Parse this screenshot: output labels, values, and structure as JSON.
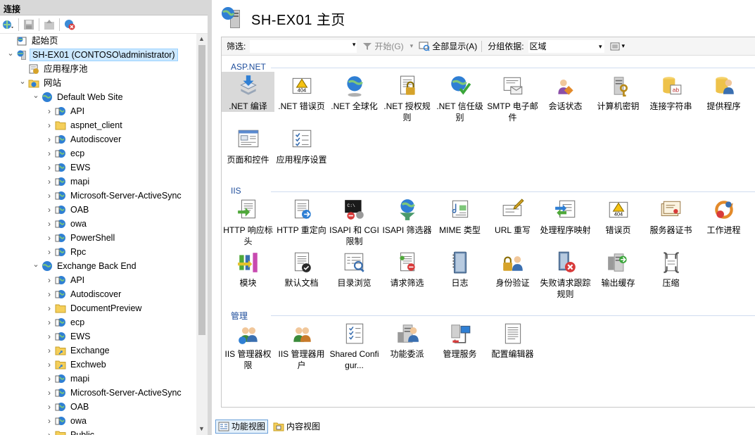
{
  "connections": {
    "header": "连接",
    "toolbar": [
      "connect-icon",
      "save-icon",
      "up-icon",
      "disconnect-icon"
    ],
    "tree": [
      {
        "label": "起始页",
        "level": 0,
        "icon": "start-page-icon",
        "exp": ""
      },
      {
        "label": "SH-EX01 (CONTOSO\\administrator)",
        "level": 0,
        "icon": "server-icon",
        "exp": "open",
        "selected": true
      },
      {
        "label": "应用程序池",
        "level": 1,
        "icon": "app-pool-icon",
        "exp": ""
      },
      {
        "label": "网站",
        "level": 1,
        "icon": "sites-folder-icon",
        "exp": "open"
      },
      {
        "label": "Default Web Site",
        "level": 2,
        "icon": "globe-site-icon",
        "exp": "open"
      },
      {
        "label": "API",
        "level": 3,
        "icon": "web-app-icon",
        "exp": "closed"
      },
      {
        "label": "aspnet_client",
        "level": 3,
        "icon": "folder-icon",
        "exp": "closed"
      },
      {
        "label": "Autodiscover",
        "level": 3,
        "icon": "web-app-icon",
        "exp": "closed"
      },
      {
        "label": "ecp",
        "level": 3,
        "icon": "web-app-icon",
        "exp": "closed"
      },
      {
        "label": "EWS",
        "level": 3,
        "icon": "web-app-icon",
        "exp": "closed"
      },
      {
        "label": "mapi",
        "level": 3,
        "icon": "web-app-icon",
        "exp": "closed"
      },
      {
        "label": "Microsoft-Server-ActiveSync",
        "level": 3,
        "icon": "web-app-icon",
        "exp": "closed"
      },
      {
        "label": "OAB",
        "level": 3,
        "icon": "web-app-icon",
        "exp": "closed"
      },
      {
        "label": "owa",
        "level": 3,
        "icon": "web-app-icon",
        "exp": "closed"
      },
      {
        "label": "PowerShell",
        "level": 3,
        "icon": "web-app-icon",
        "exp": "closed"
      },
      {
        "label": "Rpc",
        "level": 3,
        "icon": "web-app-icon",
        "exp": "closed"
      },
      {
        "label": "Exchange Back End",
        "level": 2,
        "icon": "globe-site-icon",
        "exp": "open"
      },
      {
        "label": "API",
        "level": 3,
        "icon": "web-app-icon",
        "exp": "closed"
      },
      {
        "label": "Autodiscover",
        "level": 3,
        "icon": "web-app-icon",
        "exp": "closed"
      },
      {
        "label": "DocumentPreview",
        "level": 3,
        "icon": "folder-icon",
        "exp": "closed"
      },
      {
        "label": "ecp",
        "level": 3,
        "icon": "web-app-icon",
        "exp": "closed"
      },
      {
        "label": "EWS",
        "level": 3,
        "icon": "web-app-icon",
        "exp": "closed"
      },
      {
        "label": "Exchange",
        "level": 3,
        "icon": "virtual-dir-icon",
        "exp": "closed"
      },
      {
        "label": "Exchweb",
        "level": 3,
        "icon": "virtual-dir-icon",
        "exp": "closed"
      },
      {
        "label": "mapi",
        "level": 3,
        "icon": "web-app-icon",
        "exp": "closed"
      },
      {
        "label": "Microsoft-Server-ActiveSync",
        "level": 3,
        "icon": "web-app-icon",
        "exp": "closed"
      },
      {
        "label": "OAB",
        "level": 3,
        "icon": "web-app-icon",
        "exp": "closed"
      },
      {
        "label": "owa",
        "level": 3,
        "icon": "web-app-icon",
        "exp": "closed"
      },
      {
        "label": "Public",
        "level": 3,
        "icon": "folder-icon",
        "exp": "closed"
      }
    ]
  },
  "main": {
    "title": "SH-EX01 主页",
    "filter": {
      "label": "筛选:",
      "value": "",
      "start_label": "开始(G)",
      "show_all_label": "全部显示(A)",
      "group_by_label": "分组依据:",
      "group_by_value": "区域"
    },
    "sections": [
      {
        "name": "ASP.NET",
        "features": [
          {
            "label": ".NET 编译",
            "icon": "dotnet-compilation-icon",
            "selected": true
          },
          {
            "label": ".NET 错误页",
            "icon": "dotnet-error-pages-icon"
          },
          {
            "label": ".NET 全球化",
            "icon": "dotnet-globalization-icon"
          },
          {
            "label": ".NET 授权规则",
            "icon": "dotnet-authorization-icon"
          },
          {
            "label": ".NET 信任级别",
            "icon": "dotnet-trust-levels-icon"
          },
          {
            "label": "SMTP 电子邮件",
            "icon": "smtp-email-icon"
          },
          {
            "label": "会话状态",
            "icon": "session-state-icon"
          },
          {
            "label": "计算机密钥",
            "icon": "machine-key-icon"
          },
          {
            "label": "连接字符串",
            "icon": "connection-strings-icon"
          },
          {
            "label": "提供程序",
            "icon": "providers-icon"
          },
          {
            "label": "页面和控件",
            "icon": "pages-controls-icon"
          },
          {
            "label": "应用程序设置",
            "icon": "app-settings-icon"
          }
        ]
      },
      {
        "name": "IIS",
        "features": [
          {
            "label": "HTTP 响应标头",
            "icon": "http-response-headers-icon"
          },
          {
            "label": "HTTP 重定向",
            "icon": "http-redirect-icon"
          },
          {
            "label": "ISAPI 和 CGI 限制",
            "icon": "isapi-cgi-icon"
          },
          {
            "label": "ISAPI 筛选器",
            "icon": "isapi-filters-icon"
          },
          {
            "label": "MIME 类型",
            "icon": "mime-types-icon"
          },
          {
            "label": "URL 重写",
            "icon": "url-rewrite-icon"
          },
          {
            "label": "处理程序映射",
            "icon": "handler-mappings-icon"
          },
          {
            "label": "错误页",
            "icon": "error-pages-icon"
          },
          {
            "label": "服务器证书",
            "icon": "server-certificates-icon"
          },
          {
            "label": "工作进程",
            "icon": "worker-processes-icon"
          },
          {
            "label": "模块",
            "icon": "modules-icon"
          },
          {
            "label": "默认文档",
            "icon": "default-document-icon"
          },
          {
            "label": "目录浏览",
            "icon": "directory-browsing-icon"
          },
          {
            "label": "请求筛选",
            "icon": "request-filtering-icon"
          },
          {
            "label": "日志",
            "icon": "logging-icon"
          },
          {
            "label": "身份验证",
            "icon": "authentication-icon"
          },
          {
            "label": "失败请求跟踪规则",
            "icon": "failed-request-tracing-icon"
          },
          {
            "label": "输出缓存",
            "icon": "output-caching-icon"
          },
          {
            "label": "压缩",
            "icon": "compression-icon"
          }
        ]
      },
      {
        "name": "管理",
        "features": [
          {
            "label": "IIS 管理器权限",
            "icon": "iis-manager-permissions-icon"
          },
          {
            "label": "IIS 管理器用户",
            "icon": "iis-manager-users-icon"
          },
          {
            "label": "Shared Configur...",
            "icon": "shared-configuration-icon"
          },
          {
            "label": "功能委派",
            "icon": "feature-delegation-icon"
          },
          {
            "label": "管理服务",
            "icon": "management-service-icon"
          },
          {
            "label": "配置编辑器",
            "icon": "configuration-editor-icon"
          }
        ]
      }
    ],
    "bottom_tabs": [
      {
        "label": "功能视图",
        "icon": "features-view-icon",
        "active": true
      },
      {
        "label": "内容视图",
        "icon": "content-view-icon",
        "active": false
      }
    ]
  },
  "colors": {
    "section_header": "#1f4e9c",
    "selected_tree": "#cce8ff",
    "selected_feature": "#d9d9d9"
  }
}
